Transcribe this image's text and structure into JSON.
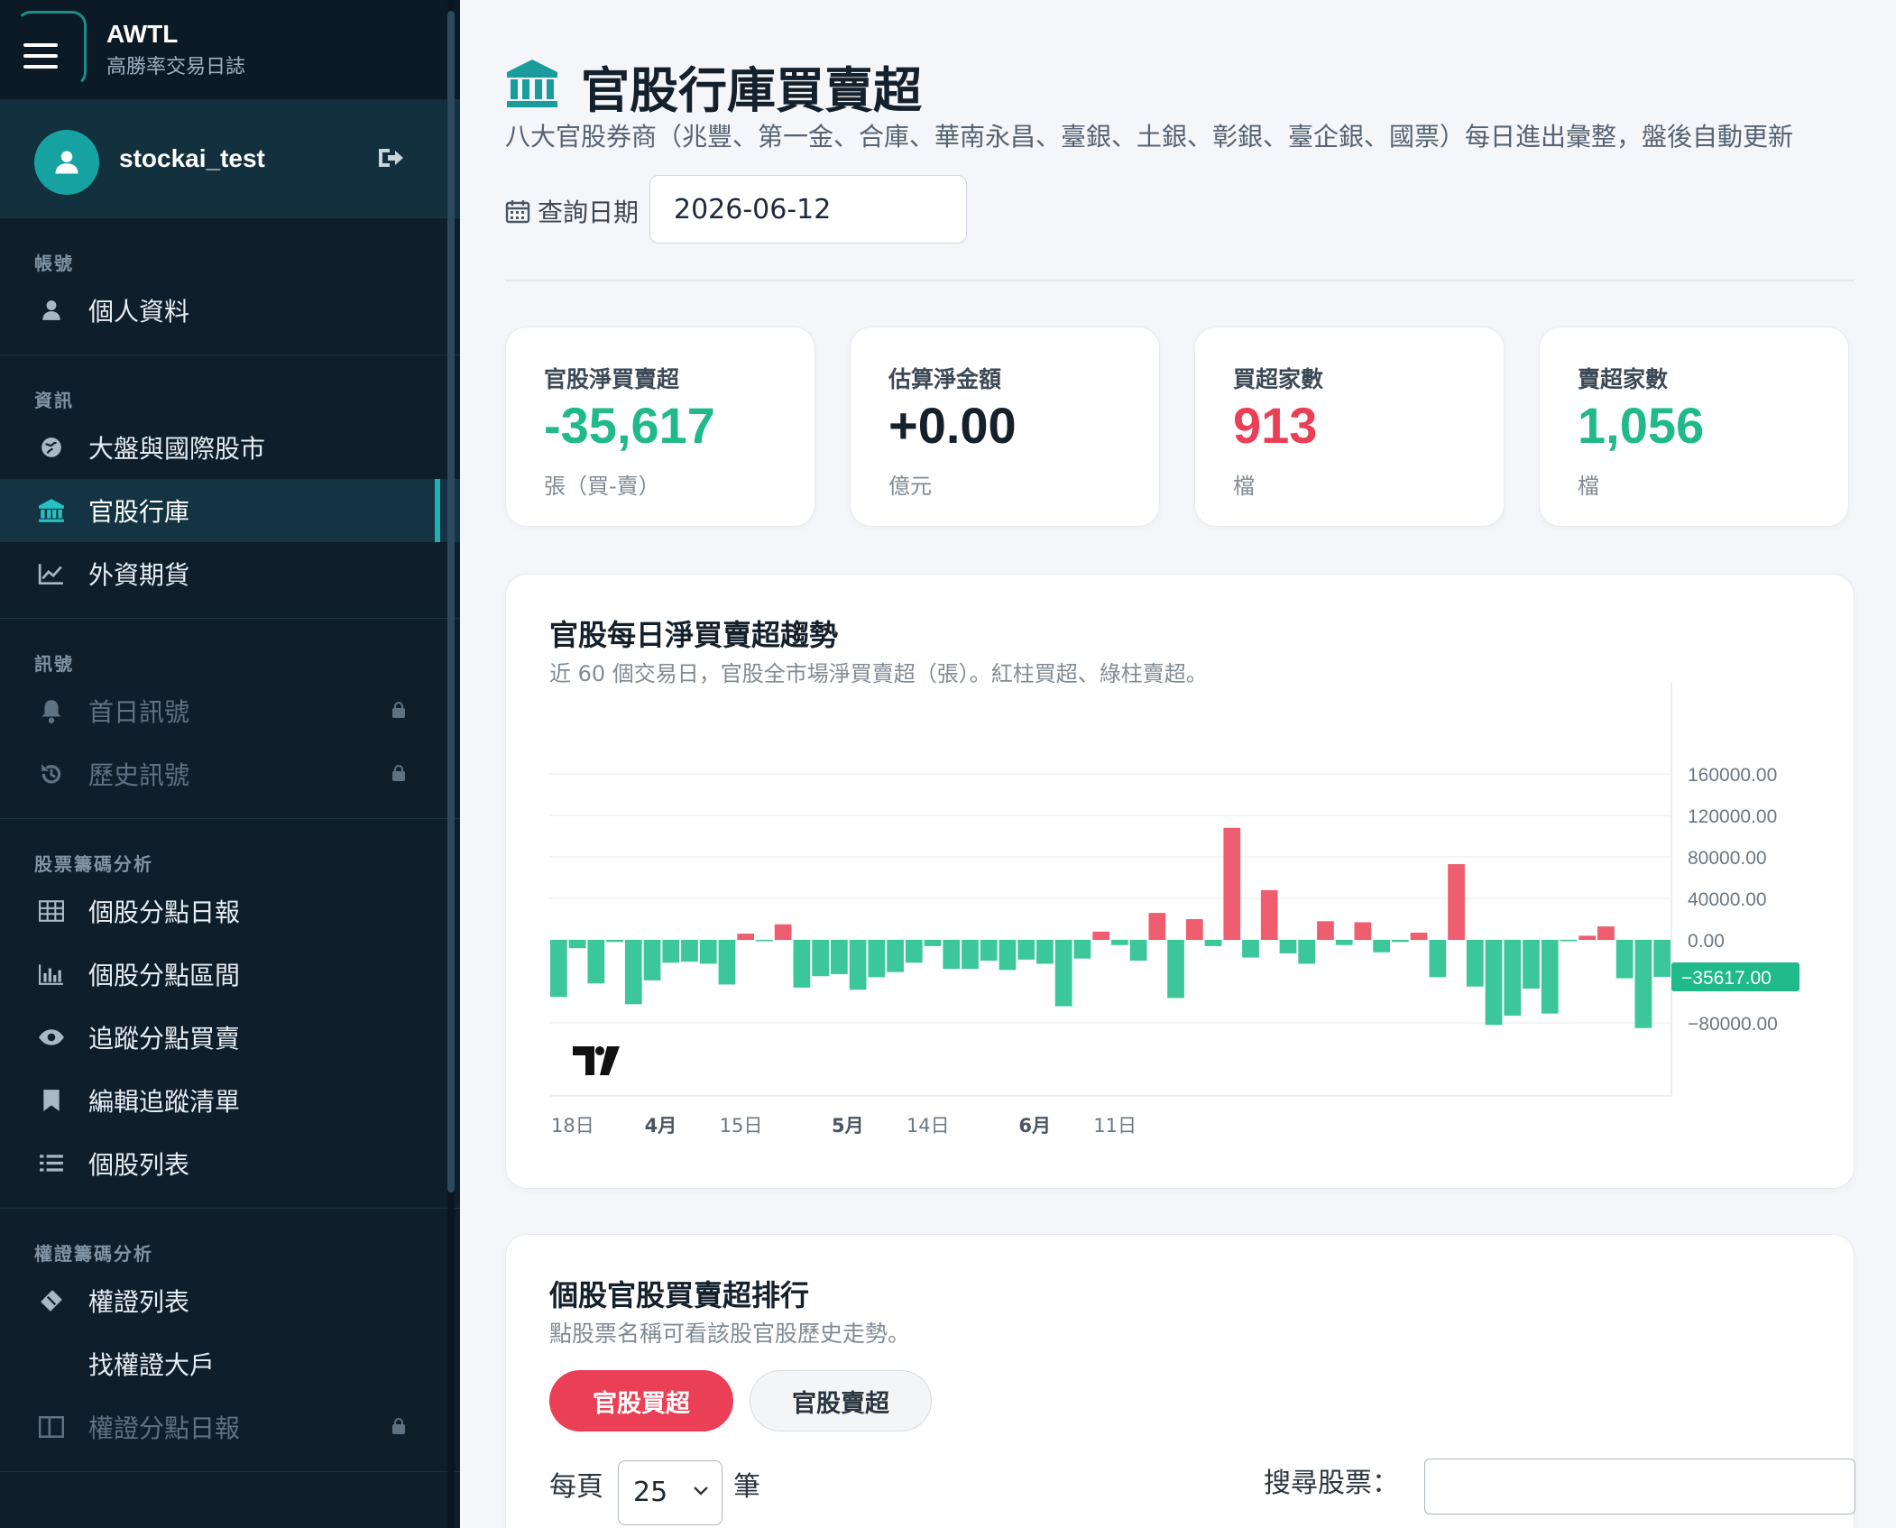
{
  "brand": {
    "title": "AWTL",
    "subtitle": "高勝率交易日誌"
  },
  "user": {
    "name": "stockai_test"
  },
  "sidebar": {
    "groups": [
      {
        "label": "帳號",
        "items": [
          {
            "label": "個人資料",
            "icon": "user-icon"
          }
        ]
      },
      {
        "label": "資訊",
        "items": [
          {
            "label": "大盤與國際股市",
            "icon": "globe-icon"
          },
          {
            "label": "官股行庫",
            "icon": "bank-icon",
            "active": true
          },
          {
            "label": "外資期貨",
            "icon": "line-chart-icon"
          }
        ]
      },
      {
        "label": "訊號",
        "items": [
          {
            "label": "首日訊號",
            "icon": "bell-icon",
            "locked": true
          },
          {
            "label": "歷史訊號",
            "icon": "history-icon",
            "locked": true
          }
        ]
      },
      {
        "label": "股票籌碼分析",
        "items": [
          {
            "label": "個股分點日報",
            "icon": "table-icon"
          },
          {
            "label": "個股分點區間",
            "icon": "bar-chart-icon"
          },
          {
            "label": "追蹤分點買賣",
            "icon": "eye-icon"
          },
          {
            "label": "編輯追蹤清單",
            "icon": "bookmark-icon"
          },
          {
            "label": "個股列表",
            "icon": "list-icon"
          }
        ]
      },
      {
        "label": "權證籌碼分析",
        "items": [
          {
            "label": "權證列表",
            "icon": "ticket-icon"
          },
          {
            "label": "找權證大戶",
            "icon": "none"
          },
          {
            "label": "權證分點日報",
            "icon": "columns-icon",
            "locked": true
          }
        ]
      }
    ]
  },
  "page": {
    "title": "官股行庫買賣超",
    "subtitle": "八大官股券商（兆豐、第一金、合庫、華南永昌、臺銀、土銀、彰銀、臺企銀、國票）每日進出彙整，盤後自動更新",
    "date_label": "查詢日期",
    "date_value": "2026-06-12"
  },
  "stats": [
    {
      "label": "官股淨買賣超",
      "value": "-35,617",
      "unit": "張（買-賣）",
      "color": "#1fb98a"
    },
    {
      "label": "估算淨金額",
      "value": "+0.00",
      "unit": "億元",
      "color": "#14202b"
    },
    {
      "label": "買超家數",
      "value": "913",
      "unit": "檔",
      "color": "#ea3f54"
    },
    {
      "label": "賣超家數",
      "value": "1,056",
      "unit": "檔",
      "color": "#1fb98a"
    }
  ],
  "chart": {
    "title": "官股每日淨買賣超趨勢",
    "subtitle": "近 60 個交易日，官股全市場淨買賣超（張）。紅柱買超、綠柱賣超。"
  },
  "chart_data": {
    "type": "bar",
    "ylim": [
      -110000,
      170000
    ],
    "yticks": [
      160000,
      120000,
      80000,
      40000,
      0,
      -80000
    ],
    "ytick_labels": [
      "160000.00",
      "120000.00",
      "80000.00",
      "40000.00",
      "0.00",
      "−80000.00"
    ],
    "last_value_label": "−35617.00",
    "xtick_labels": [
      {
        "label": "18日",
        "index": 0,
        "bold": false
      },
      {
        "label": "4月",
        "index": 5,
        "bold": true
      },
      {
        "label": "15日",
        "index": 9,
        "bold": false
      },
      {
        "label": "5月",
        "index": 15,
        "bold": true
      },
      {
        "label": "14日",
        "index": 19,
        "bold": false
      },
      {
        "label": "6月",
        "index": 25,
        "bold": true
      },
      {
        "label": "11日",
        "index": 29,
        "bold": false
      }
    ],
    "values": [
      -55000,
      -8000,
      -42000,
      -2000,
      -62000,
      -39000,
      -22000,
      -21000,
      -23000,
      -43000,
      6000,
      -1000,
      15000,
      -46000,
      -35000,
      -33000,
      -48000,
      -36000,
      -31000,
      -22000,
      -6000,
      -28000,
      -28000,
      -20000,
      -29000,
      -19000,
      -23000,
      -64000,
      -18000,
      8000,
      -5000,
      -20000,
      26000,
      -56000,
      20000,
      -6000,
      108000,
      -17000,
      48000,
      -13000,
      -23000,
      18000,
      -5000,
      17000,
      -12000,
      -2000,
      7000,
      -36000,
      73000,
      -45000,
      -82000,
      -73000,
      -47000,
      -71000,
      -1000,
      4000,
      13000,
      -37000,
      -85000,
      -35617
    ],
    "bar_up_color": "#ef5e6f",
    "bar_down_color": "#3cc79a"
  },
  "ranking": {
    "title": "個股官股買賣超排行",
    "subtitle": "點股票名稱可看該股官股歷史走勢。",
    "tab_buy": "官股買超",
    "tab_sell": "官股賣超",
    "per_page_prefix": "每頁",
    "per_page_value": "25",
    "per_page_suffix": "筆",
    "search_label": "搜尋股票："
  }
}
